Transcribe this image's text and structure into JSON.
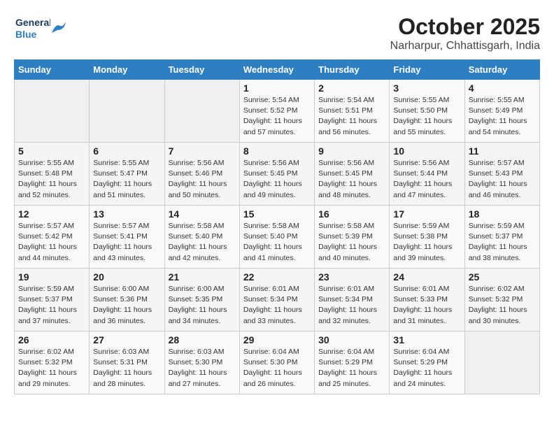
{
  "logo": {
    "line1": "General",
    "line2": "Blue"
  },
  "title": "October 2025",
  "subtitle": "Narharpur, Chhattisgarh, India",
  "weekdays": [
    "Sunday",
    "Monday",
    "Tuesday",
    "Wednesday",
    "Thursday",
    "Friday",
    "Saturday"
  ],
  "weeks": [
    [
      {
        "num": "",
        "info": ""
      },
      {
        "num": "",
        "info": ""
      },
      {
        "num": "",
        "info": ""
      },
      {
        "num": "1",
        "info": "Sunrise: 5:54 AM\nSunset: 5:52 PM\nDaylight: 11 hours\nand 57 minutes."
      },
      {
        "num": "2",
        "info": "Sunrise: 5:54 AM\nSunset: 5:51 PM\nDaylight: 11 hours\nand 56 minutes."
      },
      {
        "num": "3",
        "info": "Sunrise: 5:55 AM\nSunset: 5:50 PM\nDaylight: 11 hours\nand 55 minutes."
      },
      {
        "num": "4",
        "info": "Sunrise: 5:55 AM\nSunset: 5:49 PM\nDaylight: 11 hours\nand 54 minutes."
      }
    ],
    [
      {
        "num": "5",
        "info": "Sunrise: 5:55 AM\nSunset: 5:48 PM\nDaylight: 11 hours\nand 52 minutes."
      },
      {
        "num": "6",
        "info": "Sunrise: 5:55 AM\nSunset: 5:47 PM\nDaylight: 11 hours\nand 51 minutes."
      },
      {
        "num": "7",
        "info": "Sunrise: 5:56 AM\nSunset: 5:46 PM\nDaylight: 11 hours\nand 50 minutes."
      },
      {
        "num": "8",
        "info": "Sunrise: 5:56 AM\nSunset: 5:45 PM\nDaylight: 11 hours\nand 49 minutes."
      },
      {
        "num": "9",
        "info": "Sunrise: 5:56 AM\nSunset: 5:45 PM\nDaylight: 11 hours\nand 48 minutes."
      },
      {
        "num": "10",
        "info": "Sunrise: 5:56 AM\nSunset: 5:44 PM\nDaylight: 11 hours\nand 47 minutes."
      },
      {
        "num": "11",
        "info": "Sunrise: 5:57 AM\nSunset: 5:43 PM\nDaylight: 11 hours\nand 46 minutes."
      }
    ],
    [
      {
        "num": "12",
        "info": "Sunrise: 5:57 AM\nSunset: 5:42 PM\nDaylight: 11 hours\nand 44 minutes."
      },
      {
        "num": "13",
        "info": "Sunrise: 5:57 AM\nSunset: 5:41 PM\nDaylight: 11 hours\nand 43 minutes."
      },
      {
        "num": "14",
        "info": "Sunrise: 5:58 AM\nSunset: 5:40 PM\nDaylight: 11 hours\nand 42 minutes."
      },
      {
        "num": "15",
        "info": "Sunrise: 5:58 AM\nSunset: 5:40 PM\nDaylight: 11 hours\nand 41 minutes."
      },
      {
        "num": "16",
        "info": "Sunrise: 5:58 AM\nSunset: 5:39 PM\nDaylight: 11 hours\nand 40 minutes."
      },
      {
        "num": "17",
        "info": "Sunrise: 5:59 AM\nSunset: 5:38 PM\nDaylight: 11 hours\nand 39 minutes."
      },
      {
        "num": "18",
        "info": "Sunrise: 5:59 AM\nSunset: 5:37 PM\nDaylight: 11 hours\nand 38 minutes."
      }
    ],
    [
      {
        "num": "19",
        "info": "Sunrise: 5:59 AM\nSunset: 5:37 PM\nDaylight: 11 hours\nand 37 minutes."
      },
      {
        "num": "20",
        "info": "Sunrise: 6:00 AM\nSunset: 5:36 PM\nDaylight: 11 hours\nand 36 minutes."
      },
      {
        "num": "21",
        "info": "Sunrise: 6:00 AM\nSunset: 5:35 PM\nDaylight: 11 hours\nand 34 minutes."
      },
      {
        "num": "22",
        "info": "Sunrise: 6:01 AM\nSunset: 5:34 PM\nDaylight: 11 hours\nand 33 minutes."
      },
      {
        "num": "23",
        "info": "Sunrise: 6:01 AM\nSunset: 5:34 PM\nDaylight: 11 hours\nand 32 minutes."
      },
      {
        "num": "24",
        "info": "Sunrise: 6:01 AM\nSunset: 5:33 PM\nDaylight: 11 hours\nand 31 minutes."
      },
      {
        "num": "25",
        "info": "Sunrise: 6:02 AM\nSunset: 5:32 PM\nDaylight: 11 hours\nand 30 minutes."
      }
    ],
    [
      {
        "num": "26",
        "info": "Sunrise: 6:02 AM\nSunset: 5:32 PM\nDaylight: 11 hours\nand 29 minutes."
      },
      {
        "num": "27",
        "info": "Sunrise: 6:03 AM\nSunset: 5:31 PM\nDaylight: 11 hours\nand 28 minutes."
      },
      {
        "num": "28",
        "info": "Sunrise: 6:03 AM\nSunset: 5:30 PM\nDaylight: 11 hours\nand 27 minutes."
      },
      {
        "num": "29",
        "info": "Sunrise: 6:04 AM\nSunset: 5:30 PM\nDaylight: 11 hours\nand 26 minutes."
      },
      {
        "num": "30",
        "info": "Sunrise: 6:04 AM\nSunset: 5:29 PM\nDaylight: 11 hours\nand 25 minutes."
      },
      {
        "num": "31",
        "info": "Sunrise: 6:04 AM\nSunset: 5:29 PM\nDaylight: 11 hours\nand 24 minutes."
      },
      {
        "num": "",
        "info": ""
      }
    ]
  ]
}
